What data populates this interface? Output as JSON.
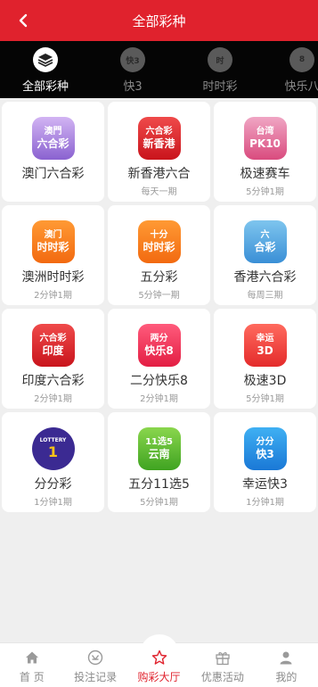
{
  "header": {
    "title": "全部彩种"
  },
  "tabs": [
    {
      "label": "全部彩种",
      "icon": "layers-icon",
      "active": true
    },
    {
      "label": "快3",
      "icon": "k3-icon",
      "active": false
    },
    {
      "label": "时时彩",
      "icon": "ssc-icon",
      "active": false
    },
    {
      "label": "快乐八",
      "icon": "kl8-icon",
      "active": false
    }
  ],
  "games": [
    {
      "name": "澳门六合彩",
      "freq": "",
      "logo": [
        "澳門",
        "六合彩"
      ]
    },
    {
      "name": "新香港六合",
      "freq": "每天一期",
      "logo": [
        "六合彩",
        "新香港"
      ]
    },
    {
      "name": "极速赛车",
      "freq": "5分钟1期",
      "logo": [
        "台湾",
        "PK10"
      ]
    },
    {
      "name": "澳洲时时彩",
      "freq": "2分钟1期",
      "logo": [
        "澳门",
        "时时彩"
      ]
    },
    {
      "name": "五分彩",
      "freq": "5分钟一期",
      "logo": [
        "十分",
        "时时彩"
      ]
    },
    {
      "name": "香港六合彩",
      "freq": "每周三期",
      "logo": [
        "六",
        "合彩"
      ]
    },
    {
      "name": "印度六合彩",
      "freq": "2分钟1期",
      "logo": [
        "六合彩",
        "印度"
      ]
    },
    {
      "name": "二分快乐8",
      "freq": "2分钟1期",
      "logo": [
        "两分",
        "快乐8"
      ]
    },
    {
      "name": "极速3D",
      "freq": "5分钟1期",
      "logo": [
        "幸运",
        "3D"
      ]
    },
    {
      "name": "分分彩",
      "freq": "1分钟1期",
      "logo": [
        "LOTTERY",
        "1"
      ]
    },
    {
      "name": "五分11选5",
      "freq": "5分钟1期",
      "logo": [
        "11选5",
        "云南"
      ]
    },
    {
      "name": "幸运快3",
      "freq": "1分钟1期",
      "logo": [
        "分分",
        "快3"
      ]
    }
  ],
  "bottom_nav": [
    {
      "label": "首 页",
      "icon": "home-icon",
      "active": false
    },
    {
      "label": "投注记录",
      "icon": "record-icon",
      "active": false
    },
    {
      "label": "购彩大厅",
      "icon": "star-icon",
      "active": true
    },
    {
      "label": "优惠活动",
      "icon": "gift-icon",
      "active": false
    },
    {
      "label": "我的",
      "icon": "user-icon",
      "active": false
    }
  ],
  "colors": {
    "accent": "#e0222d",
    "tabs_bg": "#050505"
  }
}
